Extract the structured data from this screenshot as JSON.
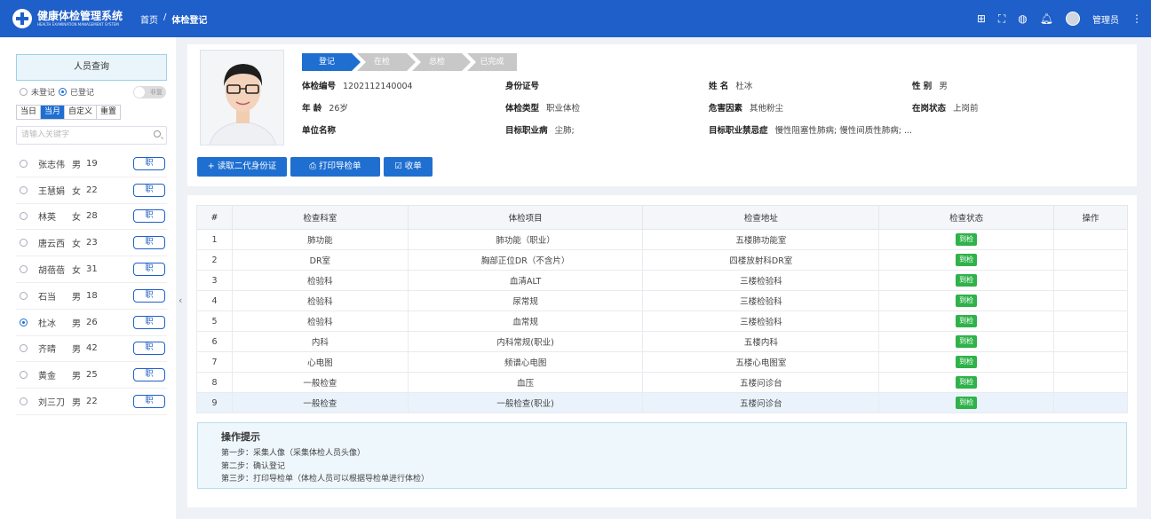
{
  "header": {
    "app_title": "健康体检管理系统",
    "app_subtitle": "HEALTH EXAMINATION MANAGEMENT SYSTEM",
    "breadcrumb": [
      "首页",
      "体检登记"
    ],
    "breadcrumb_sep": "/",
    "user": "管理员",
    "icons": [
      "apps-icon",
      "fullscreen-icon",
      "globe-icon",
      "bell-icon",
      "more-icon"
    ]
  },
  "sidebar": {
    "title": "人员查询",
    "radio_unregistered": "未登记",
    "radio_registered": "已登记",
    "radio_selected": "已登记",
    "toggle_label": "非复",
    "date_buttons": [
      "当日",
      "当月",
      "自定义",
      "重置"
    ],
    "date_active": "当月",
    "search_placeholder": "请输入关键字",
    "job_button_label": "职",
    "people": [
      {
        "name": "张志伟",
        "sex": "男",
        "age": "19",
        "selected": false
      },
      {
        "name": "王慧娟",
        "sex": "女",
        "age": "22",
        "selected": false
      },
      {
        "name": "林英",
        "sex": "女",
        "age": "28",
        "selected": false
      },
      {
        "name": "唐云西",
        "sex": "女",
        "age": "23",
        "selected": false
      },
      {
        "name": "胡蓓蓓",
        "sex": "女",
        "age": "31",
        "selected": false
      },
      {
        "name": "石当",
        "sex": "男",
        "age": "18",
        "selected": false
      },
      {
        "name": "杜冰",
        "sex": "男",
        "age": "26",
        "selected": true
      },
      {
        "name": "齐晴",
        "sex": "男",
        "age": "42",
        "selected": false
      },
      {
        "name": "黄金",
        "sex": "男",
        "age": "25",
        "selected": false
      },
      {
        "name": "刘三刀",
        "sex": "男",
        "age": "22",
        "selected": false
      }
    ]
  },
  "steps": [
    "登记",
    "在检",
    "总检",
    "已完成"
  ],
  "steps_active": "登记",
  "profile": {
    "exam_no_label": "体检编号",
    "exam_no": "1202112140004",
    "id_label": "身份证号",
    "id": "",
    "name_label": "姓 名",
    "name": "杜冰",
    "sex_label": "性 别",
    "sex": "男",
    "age_label": "年 龄",
    "age": "26岁",
    "type_label": "体检类型",
    "type": "职业体检",
    "hazard_label": "危害因素",
    "hazard": "其他粉尘",
    "post_label": "在岗状态",
    "post": "上岗前",
    "company_label": "单位名称",
    "company": "",
    "disease_label": "目标职业病",
    "disease": "尘肺;",
    "contra_label": "目标职业禁忌症",
    "contra": "慢性阻塞性肺病; 慢性间质性肺病; ..."
  },
  "actions": {
    "read_id": "+ 读取二代身份证",
    "print_guide": "打印导检单",
    "collect": "收单"
  },
  "table": {
    "headers": [
      "#",
      "检查科室",
      "体检项目",
      "检查地址",
      "检查状态",
      "操作"
    ],
    "rows": [
      {
        "no": "1",
        "dept": "肺功能",
        "item": "肺功能（职业）",
        "addr": "五楼肺功能室",
        "status": "到检"
      },
      {
        "no": "2",
        "dept": "DR室",
        "item": "胸部正位DR（不含片）",
        "addr": "四楼放射科DR室",
        "status": "到检"
      },
      {
        "no": "3",
        "dept": "检验科",
        "item": "血清ALT",
        "addr": "三楼检验科",
        "status": "到检"
      },
      {
        "no": "4",
        "dept": "检验科",
        "item": "尿常规",
        "addr": "三楼检验科",
        "status": "到检"
      },
      {
        "no": "5",
        "dept": "检验科",
        "item": "血常规",
        "addr": "三楼检验科",
        "status": "到检"
      },
      {
        "no": "6",
        "dept": "内科",
        "item": "内科常规(职业)",
        "addr": "五楼内科",
        "status": "到检"
      },
      {
        "no": "7",
        "dept": "心电图",
        "item": "频谱心电图",
        "addr": "五楼心电图室",
        "status": "到检"
      },
      {
        "no": "8",
        "dept": "一般检查",
        "item": "血压",
        "addr": "五楼问诊台",
        "status": "到检"
      },
      {
        "no": "9",
        "dept": "一般检查",
        "item": "一般检查(职业)",
        "addr": "五楼问诊台",
        "status": "到检"
      }
    ],
    "selected_row": "9"
  },
  "tips": {
    "title": "操作提示",
    "lines": [
      "第一步：采集人像（采集体检人员头像）",
      "第二步：确认登记",
      "第三步：打印导检单（体检人员可以根据导检单进行体检）"
    ]
  }
}
